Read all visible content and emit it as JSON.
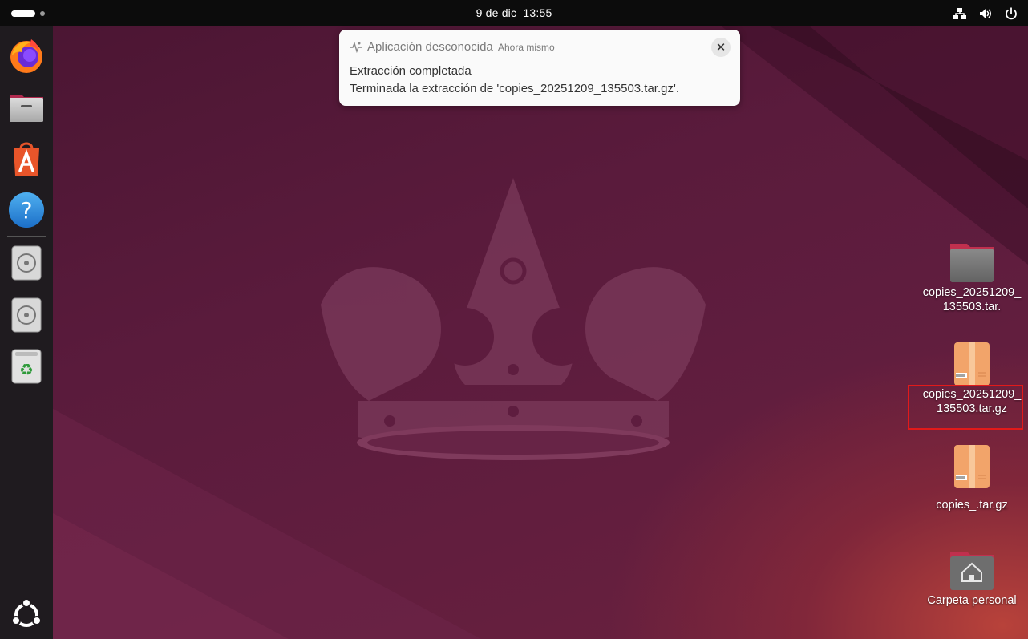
{
  "top_bar": {
    "clock_date": "9 de dic",
    "clock_time": "13:55",
    "tray_icons": [
      "network-icon",
      "volume-icon",
      "power-icon"
    ]
  },
  "dock": {
    "items": [
      {
        "name": "firefox-icon"
      },
      {
        "name": "files-icon"
      },
      {
        "name": "app-center-icon"
      },
      {
        "name": "help-icon"
      },
      {
        "name": "disc-drive-icon"
      },
      {
        "name": "disc-drive-icon"
      },
      {
        "name": "trash-icon"
      },
      {
        "name": "show-apps-icon"
      }
    ]
  },
  "notification": {
    "app_name": "Aplicación desconocida",
    "time": "Ahora mismo",
    "title": "Extracción completada",
    "body": "Terminada la extracción de 'copies_20251209_135503.tar.gz'.",
    "close_glyph": "✕"
  },
  "desktop_icons": [
    {
      "label": "copies_20251209_135503.tar.",
      "kind": "folder",
      "selected": false
    },
    {
      "label": "copies_20251209_135503.tar.gz",
      "kind": "archive",
      "selected": true
    },
    {
      "label": "copies_.tar.gz",
      "kind": "archive",
      "selected": false
    },
    {
      "label": "Carpeta personal",
      "kind": "home-folder",
      "selected": false
    }
  ],
  "colors": {
    "highlight": "#e21a1a",
    "top_bar": "#0c0c0c",
    "dock": "#1f1b1f",
    "wallpaper": "#5a1b3c"
  }
}
